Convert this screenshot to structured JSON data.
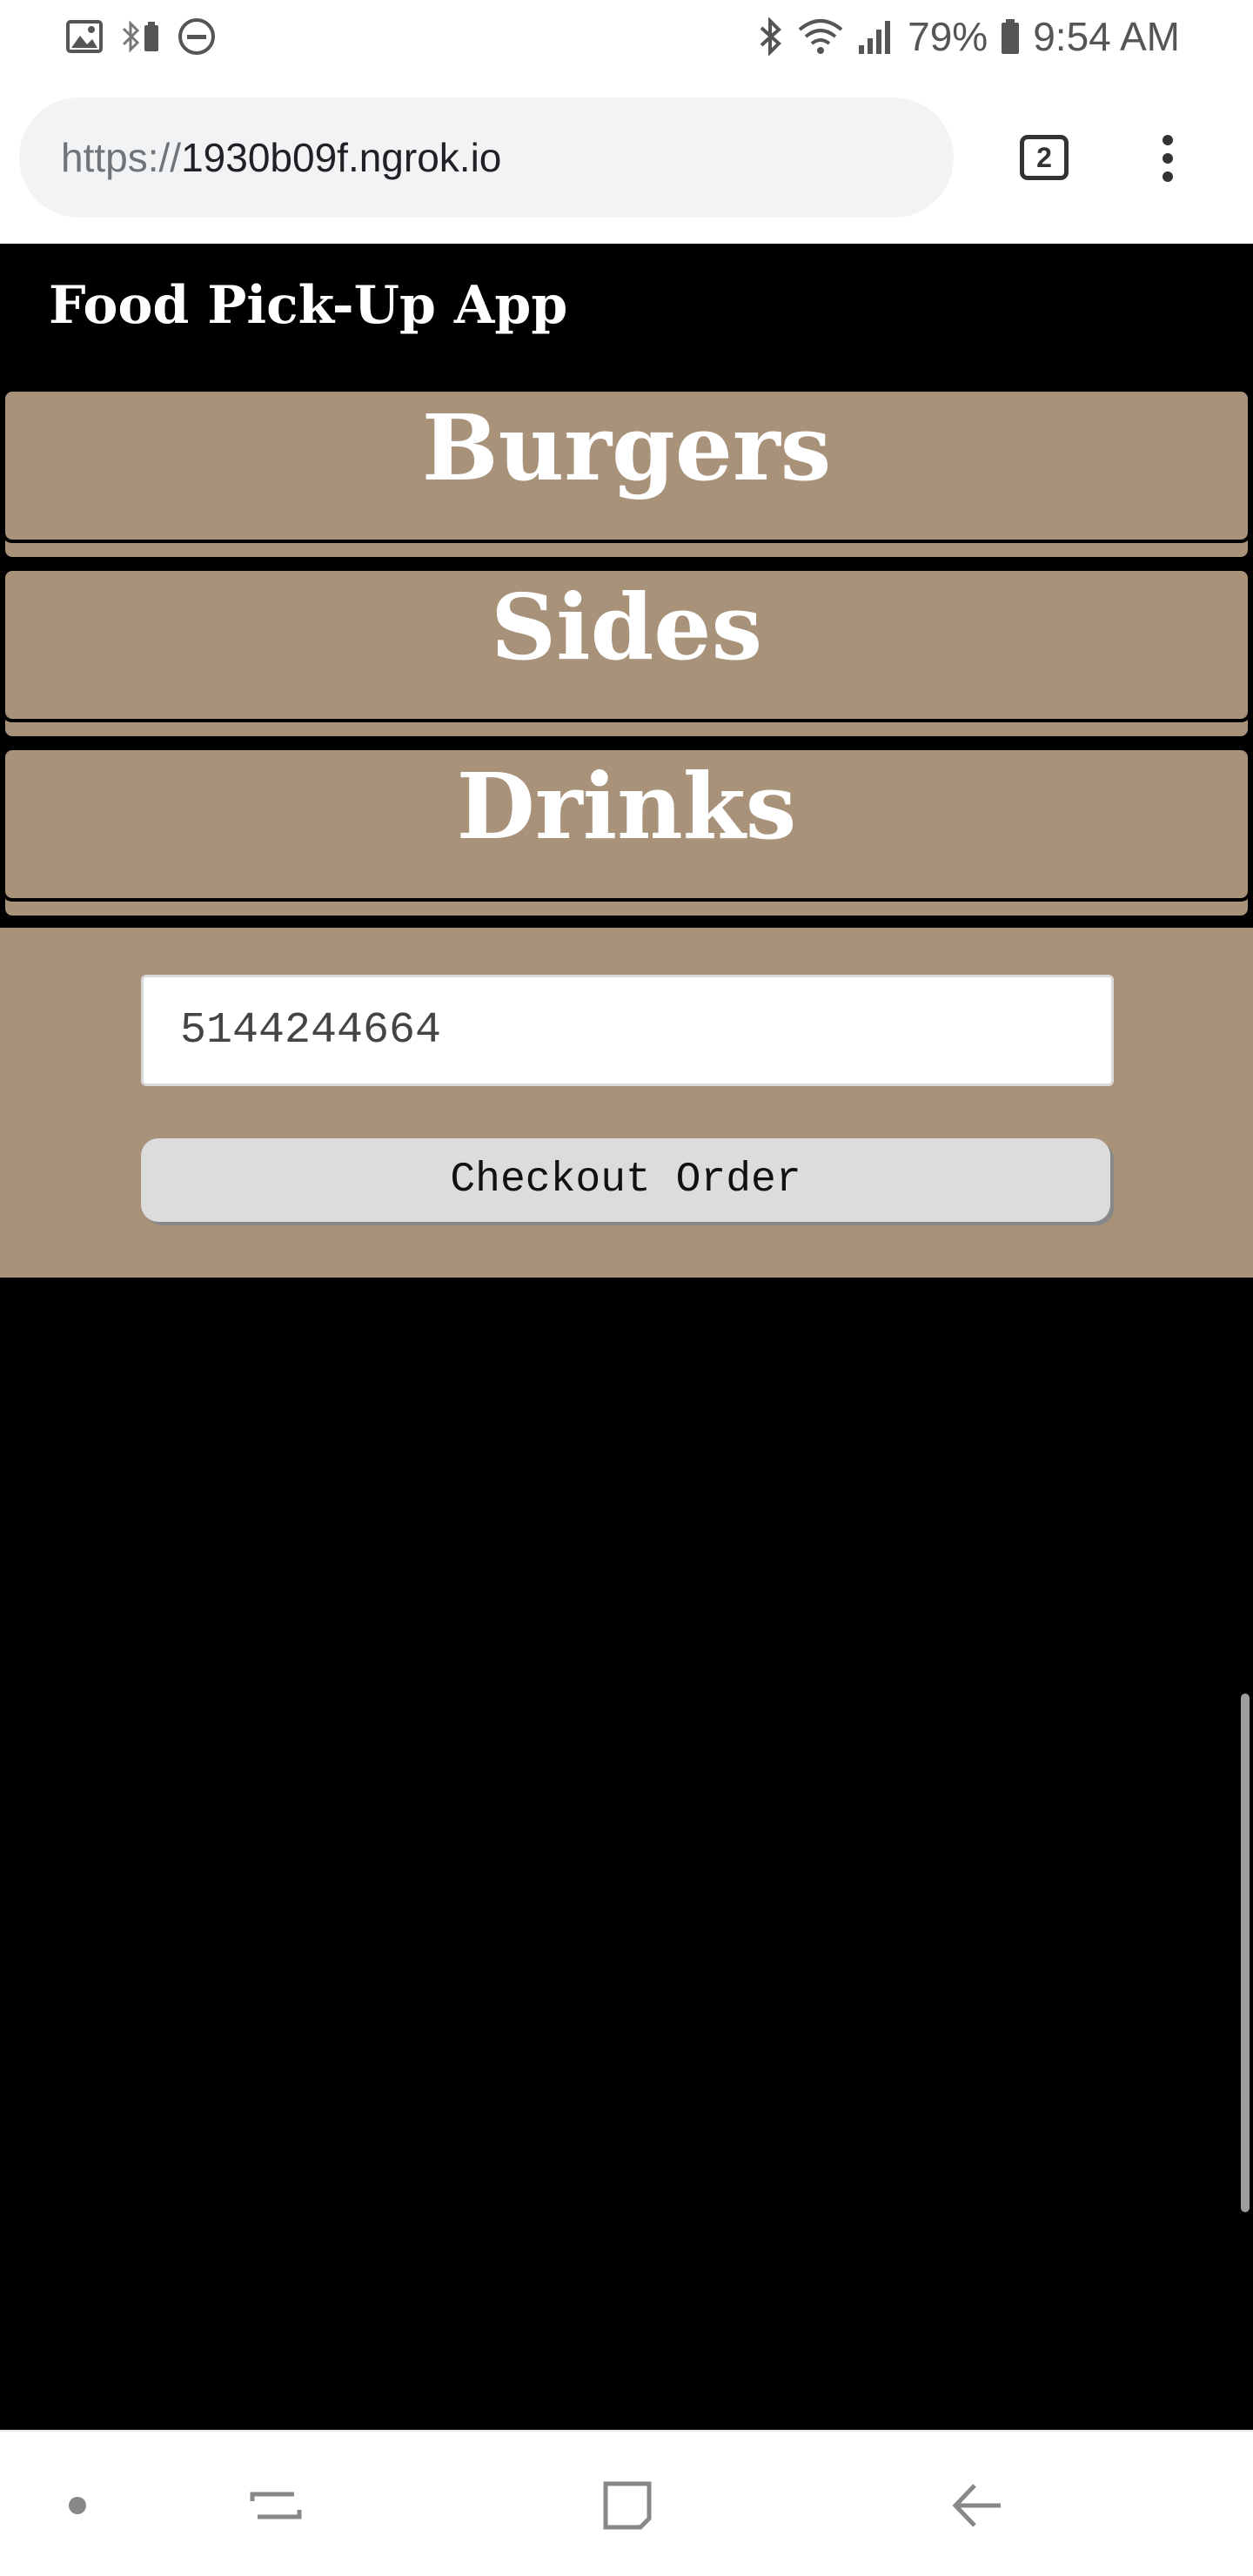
{
  "status_bar": {
    "left_icons": [
      "image-icon",
      "bluetooth-battery-icon",
      "do-not-disturb-icon"
    ],
    "right_icons": [
      "bluetooth-icon",
      "wifi-icon",
      "signal-icon",
      "battery-icon"
    ],
    "battery": "79%",
    "time": "9:54 AM"
  },
  "browser": {
    "url_scheme": "https://",
    "url_host": "1930b09f.ngrok.io",
    "tab_count": "2",
    "menu_icon": "more-vert-icon"
  },
  "app": {
    "title": "Food Pick-Up App"
  },
  "categories": [
    {
      "label": "Burgers"
    },
    {
      "label": "Sides"
    },
    {
      "label": "Drinks"
    }
  ],
  "checkout": {
    "phone_value": "5144244664",
    "button_label": "Checkout Order"
  },
  "nav_bar": {
    "icons": [
      "dot-icon",
      "recent-apps-icon",
      "home-icon",
      "back-icon"
    ]
  },
  "colors": {
    "panel": "#a89279",
    "background": "#000000",
    "button": "#dcdcdc"
  }
}
